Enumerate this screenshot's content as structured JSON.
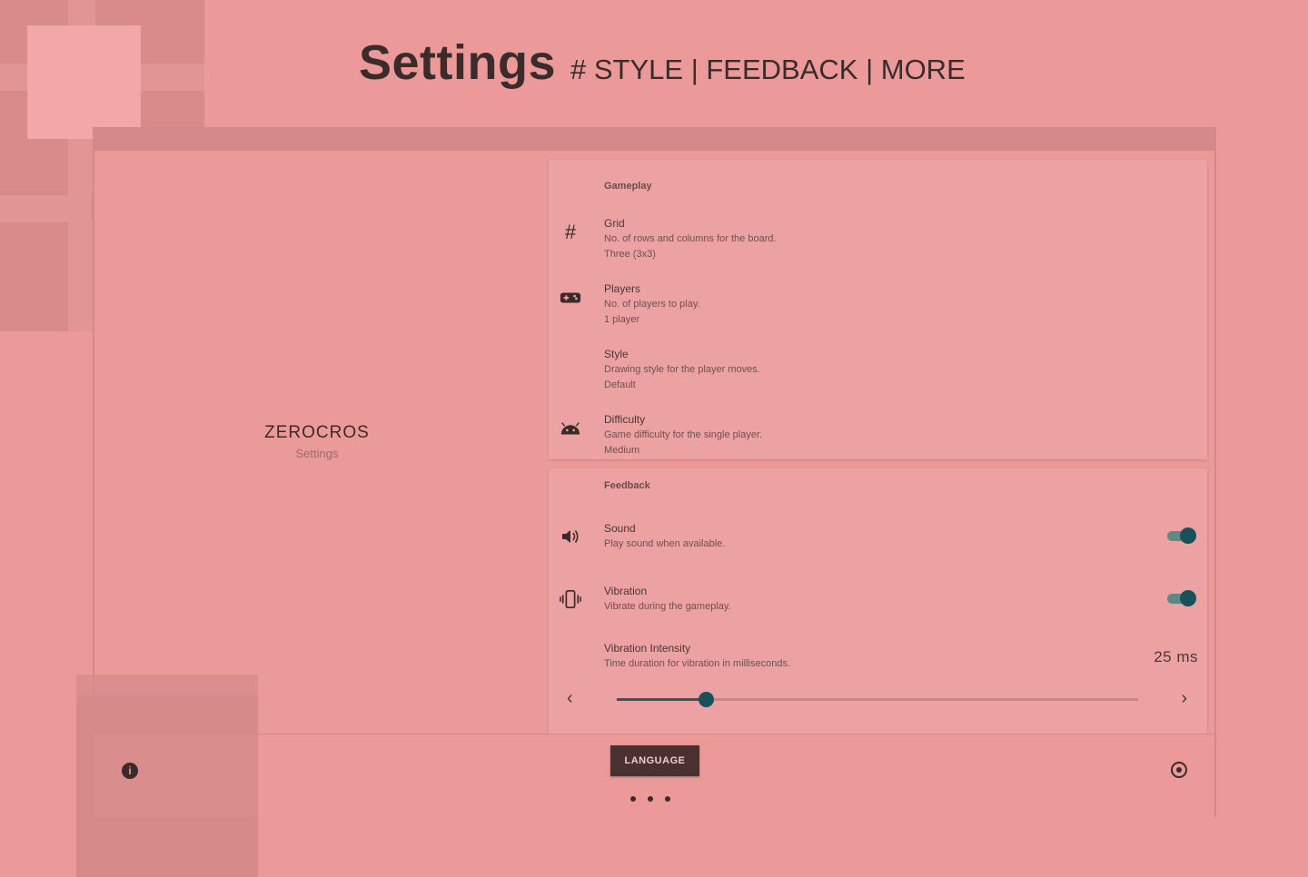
{
  "headline": {
    "title": "Settings",
    "subtitle": "# STYLE | FEEDBACK | MORE"
  },
  "app": {
    "name": "ZEROCROS",
    "tagline": "Settings"
  },
  "gameplay": {
    "title": "Gameplay",
    "items": [
      {
        "title": "Grid",
        "summary": "No. of rows and columns for the board.",
        "value": "Three (3x3)",
        "icon": "grid-hash-icon"
      },
      {
        "title": "Players",
        "summary": "No. of players to play.",
        "value": "1 player",
        "icon": "gamepad-icon"
      },
      {
        "title": "Style",
        "summary": "Drawing style for the player moves.",
        "value": "Default",
        "icon": ""
      },
      {
        "title": "Difficulty",
        "summary": "Game difficulty for the single player.",
        "value": "Medium",
        "icon": "android-icon"
      }
    ]
  },
  "feedback": {
    "title": "Feedback",
    "sound": {
      "title": "Sound",
      "summary": "Play sound when available.",
      "enabled": true,
      "icon": "speaker-icon"
    },
    "vibration": {
      "title": "Vibration",
      "summary": "Vibrate during the gameplay.",
      "enabled": true,
      "icon": "vibration-icon"
    },
    "vibration_intensity": {
      "title": "Vibration Intensity",
      "summary": "Time duration for vibration in milliseconds.",
      "value_label": "25 ms",
      "slider_fraction": 0.17,
      "prev_arrow": "‹",
      "next_arrow": "›"
    }
  },
  "footer": {
    "language_button": "LANGUAGE",
    "info_icon": "info-icon",
    "target_icon": "target-icon",
    "page_dots": 3,
    "info_glyph": "i"
  },
  "colors": {
    "background": "#ec9999",
    "accent": "#19505a",
    "button": "#4b3030"
  }
}
